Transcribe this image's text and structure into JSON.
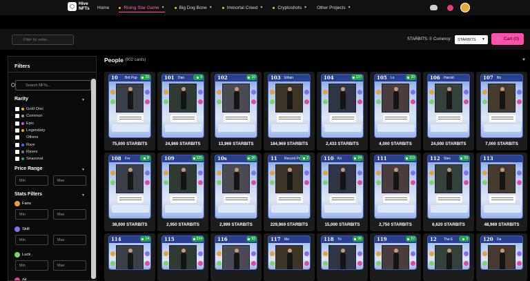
{
  "nav": {
    "logo_line1": "Hive",
    "logo_line2": "NFTs",
    "items": [
      {
        "label": "Home",
        "dot": false,
        "caret": false,
        "active": false
      },
      {
        "label": "Rising Star Game",
        "dot": true,
        "caret": true,
        "active": true
      },
      {
        "label": "Big Dog Bone",
        "dot": true,
        "caret": true,
        "active": false
      },
      {
        "label": "Immortal Creed",
        "dot": true,
        "caret": true,
        "active": false
      },
      {
        "label": "Cryptoshots",
        "dot": true,
        "caret": true,
        "active": false
      },
      {
        "label": "Other Projects",
        "dot": false,
        "caret": true,
        "active": false
      }
    ],
    "icons": [
      "discord-icon",
      "profile-icon",
      "avatar"
    ]
  },
  "toolbar": {
    "seller_placeholder": "Filter by seller...",
    "starbits_label": "STARBITS: 0",
    "currency_label": "Currency:",
    "currency_value": "STARBITS",
    "cart_label": "Cart (0)"
  },
  "sidebar": {
    "title": "Filters",
    "search_placeholder": "Search NFTs...",
    "rarity_title": "Rarity",
    "rarities": [
      {
        "label": "Gold Disc",
        "color": "#f2b91f"
      },
      {
        "label": "Common",
        "color": "#9aa0a6"
      },
      {
        "label": "Epic",
        "color": "#c05ad8"
      },
      {
        "label": "Legendary",
        "color": "#f2a01f"
      },
      {
        "label": "Others",
        "color": ""
      },
      {
        "label": "Rare",
        "color": "#3b6ee0"
      },
      {
        "label": "Raves",
        "color": "#6f7a86"
      },
      {
        "label": "Seasonal",
        "color": "#2aa36a"
      }
    ],
    "price_title": "Price Range",
    "min_placeholder": "Min",
    "max_placeholder": "Max",
    "stats_title": "Stats Filters",
    "stats": [
      {
        "label": "Fans",
        "color": "#e0a43a"
      },
      {
        "label": "Skill",
        "color": "#8a6cf0"
      },
      {
        "label": "Luck",
        "color": "#7dd36a"
      },
      {
        "label": "IM",
        "color": "#e04a9a"
      }
    ]
  },
  "main": {
    "section_title": "People",
    "section_count": "(802 cards)",
    "cards": [
      {
        "num": "10",
        "name": "Brit Pop",
        "badge": "25",
        "price": "75,000 STARBITS"
      },
      {
        "num": "101",
        "name": "Dan",
        "badge": "9",
        "price": "24,969 STARBITS"
      },
      {
        "num": "102",
        "name": "",
        "badge": "10",
        "price": "13,969 STARBITS"
      },
      {
        "num": "103",
        "name": "Ethan",
        "badge": "",
        "price": "184,969 STARBITS"
      },
      {
        "num": "104",
        "name": "",
        "badge": "137",
        "price": "2,433 STARBITS"
      },
      {
        "num": "105",
        "name": "Lo",
        "badge": "20",
        "price": "4,000 STARBITS"
      },
      {
        "num": "106",
        "name": "Harold",
        "badge": "",
        "price": "24,000 STARBITS"
      },
      {
        "num": "107",
        "name": "Bo",
        "badge": "",
        "price": "7,000 STARBITS"
      },
      {
        "num": "108",
        "name": "Fre",
        "badge": "8",
        "price": "38,000 STARBITS"
      },
      {
        "num": "109",
        "name": "",
        "badge": "125",
        "price": "2,950 STARBITS"
      },
      {
        "num": "10s",
        "name": "",
        "badge": "30",
        "price": "2,999 STARBITS"
      },
      {
        "num": "11",
        "name": "Record Produ",
        "badge": "2",
        "price": "229,969 STARBITS"
      },
      {
        "num": "110",
        "name": "Kri",
        "badge": "24",
        "price": "15,000 STARBITS"
      },
      {
        "num": "111",
        "name": "",
        "badge": "110",
        "price": "2,750 STARBITS"
      },
      {
        "num": "112",
        "name": "Stev",
        "badge": "59",
        "price": "6,620 STARBITS"
      },
      {
        "num": "113",
        "name": "",
        "badge": "",
        "price": "48,969 STARBITS"
      },
      {
        "num": "114",
        "name": "",
        "badge": "14",
        "price": ""
      },
      {
        "num": "115",
        "name": "",
        "badge": "234",
        "price": ""
      },
      {
        "num": "116",
        "name": "",
        "badge": "92",
        "price": ""
      },
      {
        "num": "117",
        "name": "Mo",
        "badge": "",
        "price": ""
      },
      {
        "num": "118",
        "name": "Tri",
        "badge": "36",
        "price": ""
      },
      {
        "num": "119",
        "name": "",
        "badge": "57",
        "price": ""
      },
      {
        "num": "12",
        "name": "The E",
        "badge": "3",
        "price": ""
      },
      {
        "num": "120",
        "name": "Da",
        "badge": "",
        "price": ""
      }
    ]
  }
}
